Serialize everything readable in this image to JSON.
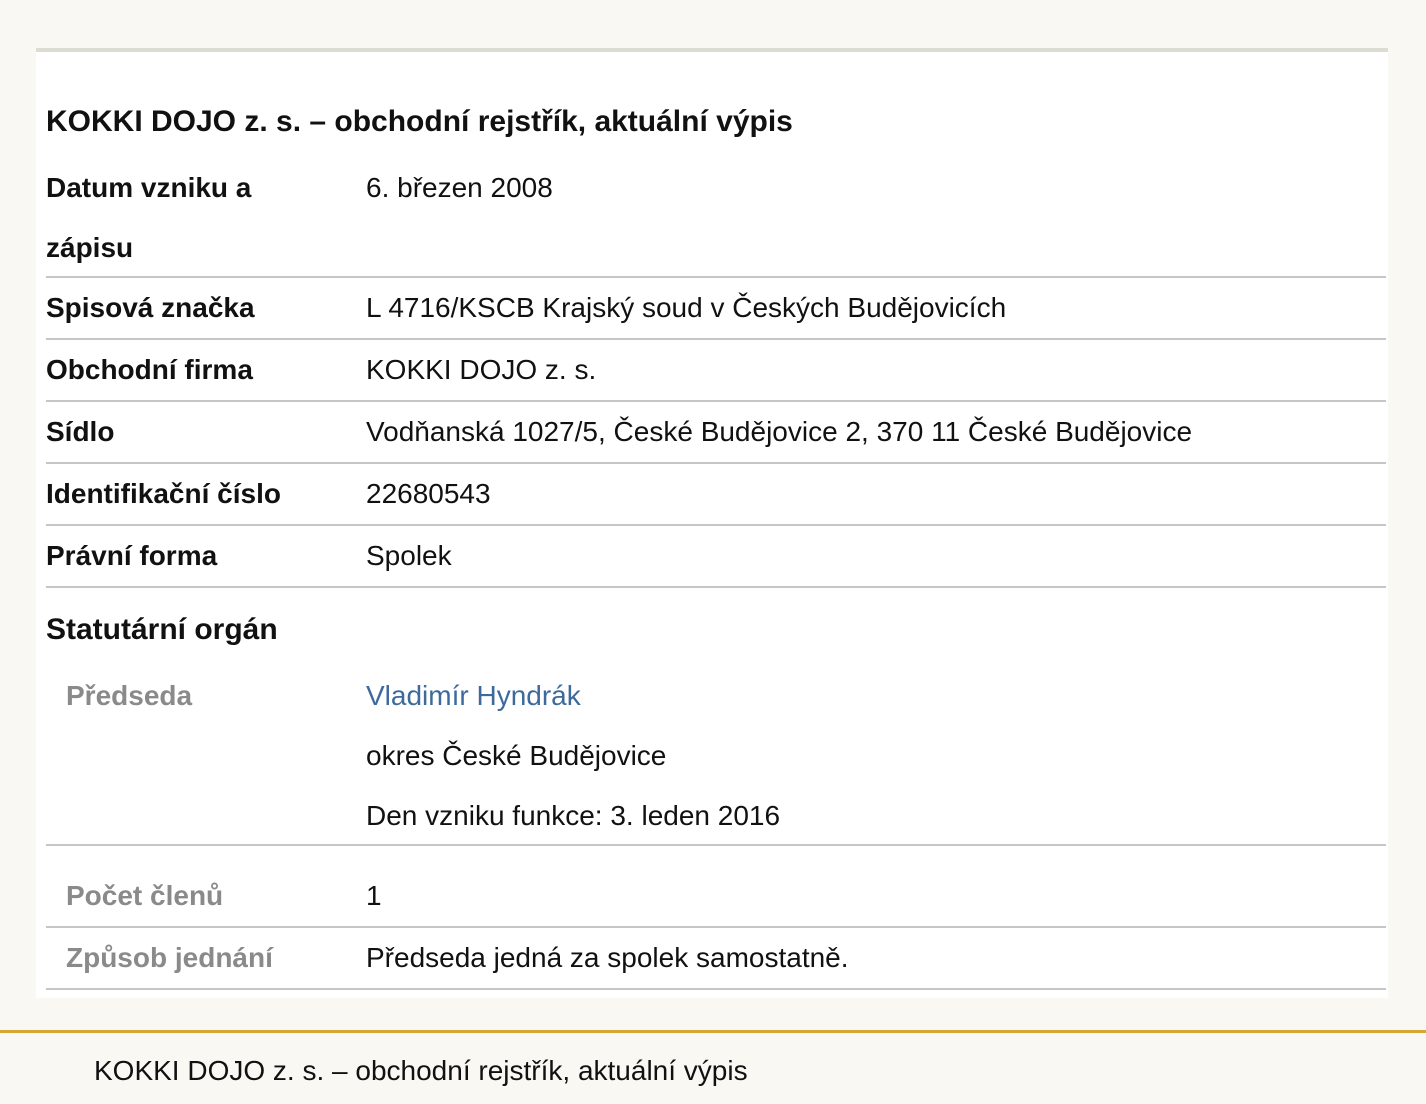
{
  "page": {
    "title": "KOKKI DOJO z. s. – obchodní rejstřík, aktuální výpis"
  },
  "record": {
    "founded_label": "Datum vzniku a zápisu",
    "founded_value": "6. březen 2008",
    "file_label": "Spisová značka",
    "file_value": "L 4716/KSCB Krajský soud v Českých Budějovicích",
    "firm_label": "Obchodní firma",
    "firm_value": "KOKKI DOJO z. s.",
    "seat_label": "Sídlo",
    "seat_value": "Vodňanská 1027/5, České Budějovice 2, 370 11 České Budějovice",
    "id_label": "Identifikační číslo",
    "id_value": "22680543",
    "legal_form_label": "Právní forma",
    "legal_form_value": "Spolek"
  },
  "statutory": {
    "heading": "Statutární orgán",
    "chair_label": "Předseda",
    "chair_name": "Vladimír Hyndrák",
    "chair_district": "okres České Budějovice",
    "chair_since": "Den vzniku funkce: 3. leden 2016",
    "members_label": "Počet členů",
    "members_value": "1",
    "acting_label": "Způsob jednání",
    "acting_value": "Předseda jedná za spolek samostatně."
  },
  "footer": {
    "text": "KOKKI DOJO z. s. – obchodní rejstřík, aktuální výpis"
  }
}
